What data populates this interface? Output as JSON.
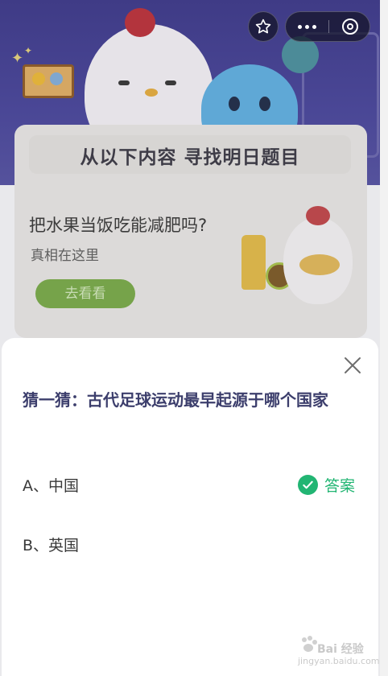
{
  "window": {
    "title": ""
  },
  "ad_card": {
    "title": "从以下内容 寻找明日题目",
    "headline": "把水果当饭吃能减肥吗?",
    "subline": "真相在这里",
    "button_label": "去看看"
  },
  "quiz": {
    "question": "猜一猜：古代足球运动最早起源于哪个国家",
    "options": [
      {
        "label": "A、中国",
        "is_answer": true
      },
      {
        "label": "B、英国",
        "is_answer": false
      }
    ],
    "answer_label": "答案"
  },
  "watermark": {
    "brand": "Bai 经验",
    "url": "jingyan.baidu.com"
  },
  "icons": {
    "star": "star-icon",
    "more": "more-dots-icon",
    "exit": "circle-close-icon",
    "close": "close-icon",
    "check": "check-icon"
  },
  "colors": {
    "question_text": "#3c3e6c",
    "answer_green": "#22b573",
    "hero_bg": "#3f3b86",
    "ad_button": "#76a34a"
  }
}
